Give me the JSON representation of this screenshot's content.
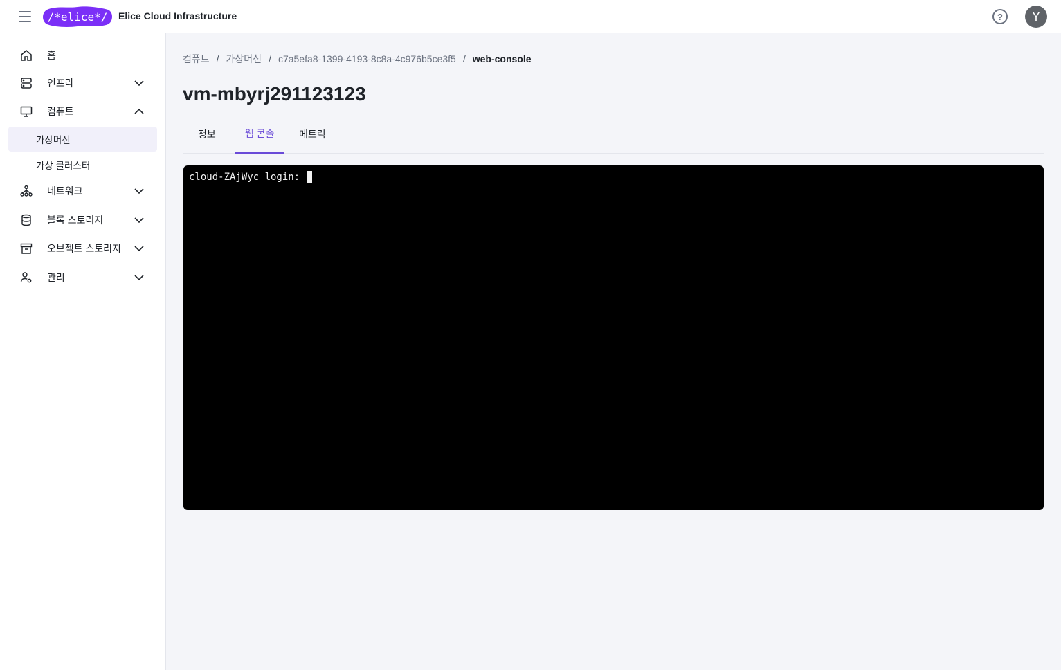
{
  "header": {
    "logo_text": "/*elice*/",
    "app_title": "Elice Cloud Infrastructure",
    "help_icon": "question-circle-icon",
    "help_glyph": "?",
    "avatar_initial": "Y"
  },
  "sidebar": {
    "items": [
      {
        "label": "홈",
        "icon": "home-icon"
      },
      {
        "label": "인프라",
        "icon": "server-icon",
        "expanded": false
      },
      {
        "label": "컴퓨트",
        "icon": "monitor-icon",
        "expanded": true
      },
      {
        "label": "네트워크",
        "icon": "network-icon",
        "expanded": false
      },
      {
        "label": "블록 스토리지",
        "icon": "database-icon",
        "expanded": false
      },
      {
        "label": "오브젝트 스토리지",
        "icon": "archive-icon",
        "expanded": false
      },
      {
        "label": "관리",
        "icon": "user-settings-icon",
        "expanded": false
      }
    ],
    "compute_children": [
      {
        "label": "가상머신",
        "active": true
      },
      {
        "label": "가상 클러스터",
        "active": false
      }
    ]
  },
  "breadcrumb": {
    "items": [
      "컴퓨트",
      "가상머신",
      "c7a5efa8-1399-4193-8c8a-4c976b5ce3f5",
      "web-console"
    ],
    "separator": "/"
  },
  "page": {
    "title": "vm-mbyrj291123123"
  },
  "tabs": [
    {
      "label": "정보",
      "active": false
    },
    {
      "label": "웹 콘솔",
      "active": true
    },
    {
      "label": "메트릭",
      "active": false
    }
  ],
  "console": {
    "text": "cloud-ZAjWyc login: "
  },
  "colors": {
    "accent": "#6a4bd8",
    "logo": "#7b2ff7",
    "console_bg": "#000000"
  }
}
